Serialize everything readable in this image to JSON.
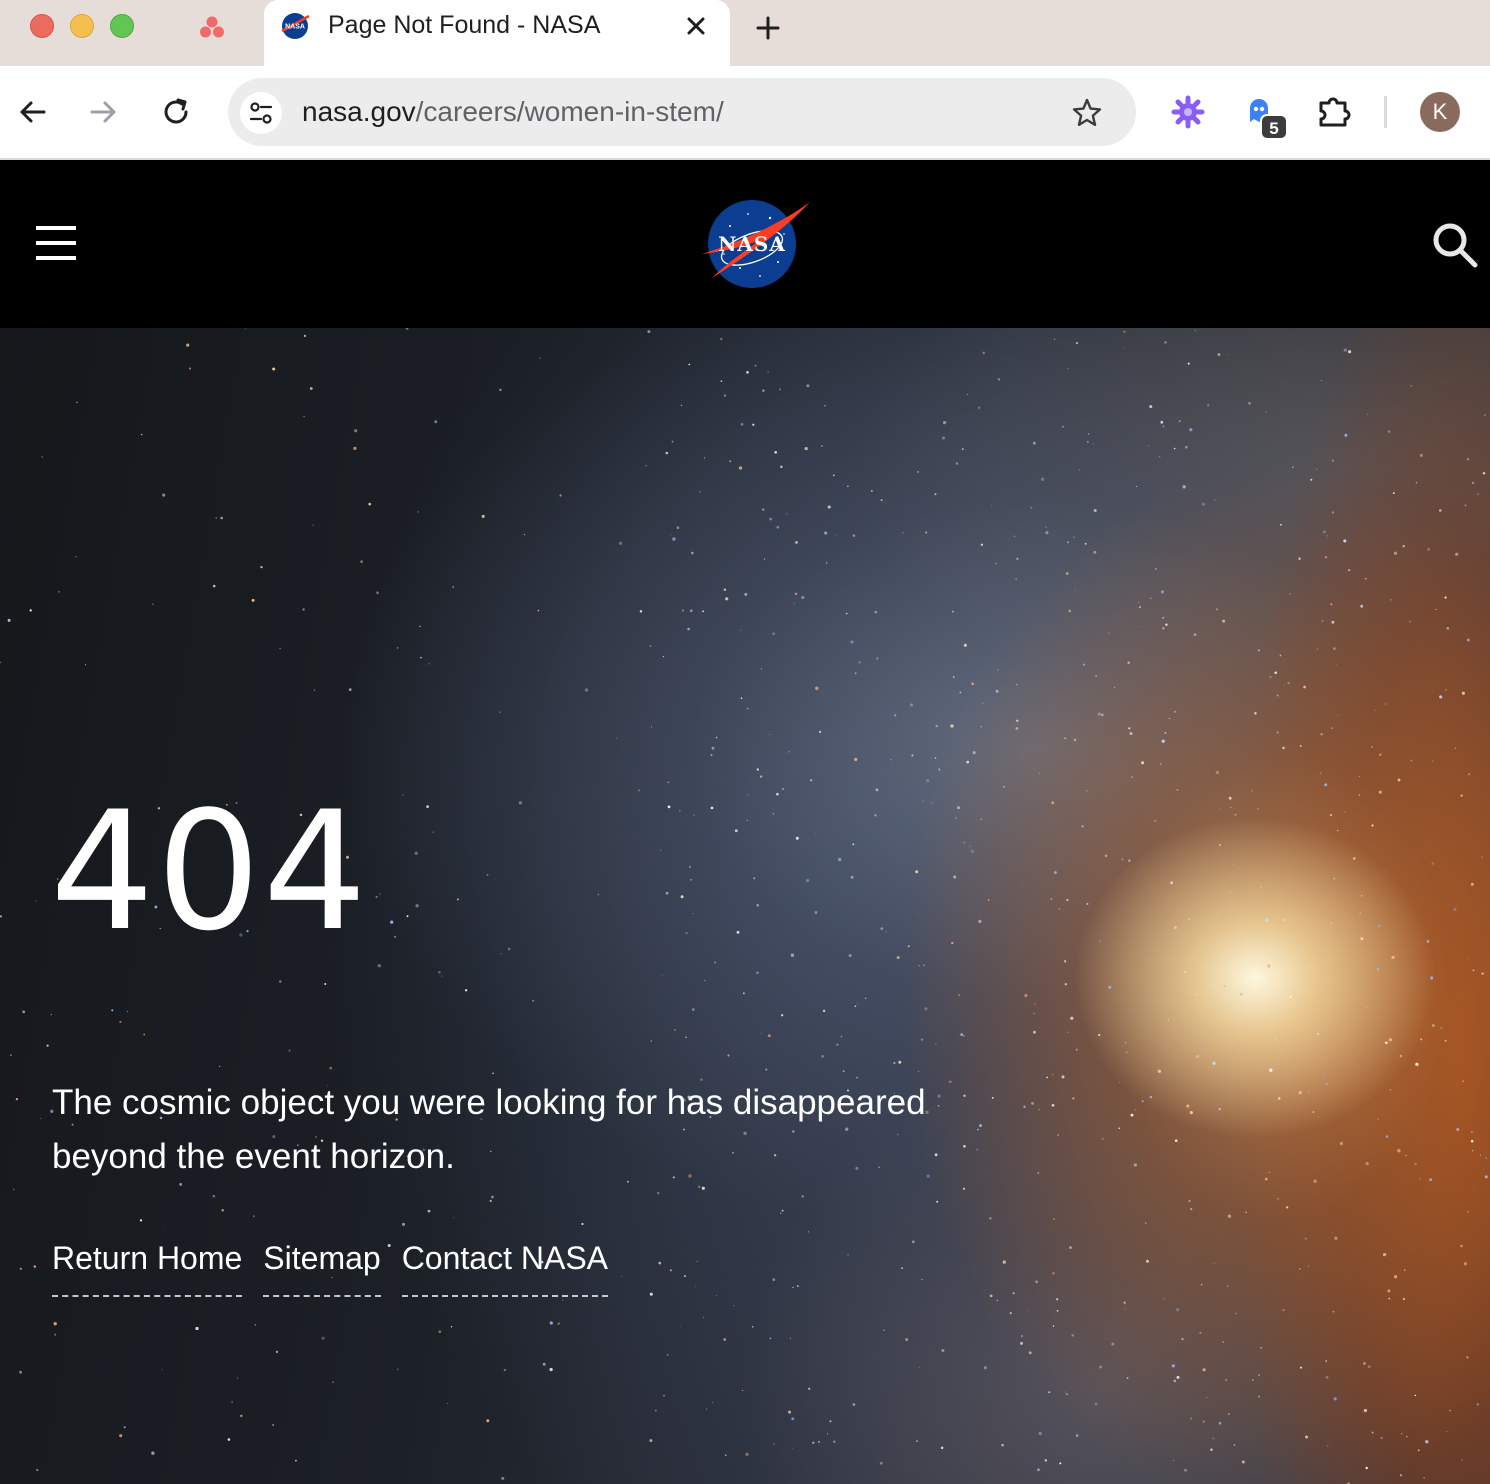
{
  "browser": {
    "tab": {
      "title": "Page Not Found - NASA",
      "favicon": "nasa-meatball-icon"
    },
    "pinned_tab_icon": "asana-icon",
    "address": {
      "host": "nasa.gov",
      "path": "/careers/women-in-stem/"
    },
    "extensions": [
      {
        "icon": "gear-extension-icon"
      },
      {
        "icon": "ghost-extension-icon",
        "badge": "5"
      },
      {
        "icon": "puzzle-icon"
      }
    ],
    "profile_initial": "K",
    "colors": {
      "tabbar": "#e6dcd8",
      "omnibox": "#ececec",
      "avatar": "#8a6a5f"
    }
  },
  "site": {
    "logo": "nasa-meatball-logo",
    "menu_icon": "hamburger-icon",
    "search_icon": "search-icon",
    "error": {
      "code": "404",
      "message": "The cosmic object you were looking for has disappeared beyond the event horizon."
    },
    "links": [
      {
        "label": "Return Home"
      },
      {
        "label": "Sitemap"
      },
      {
        "label": "Contact NASA"
      }
    ]
  }
}
